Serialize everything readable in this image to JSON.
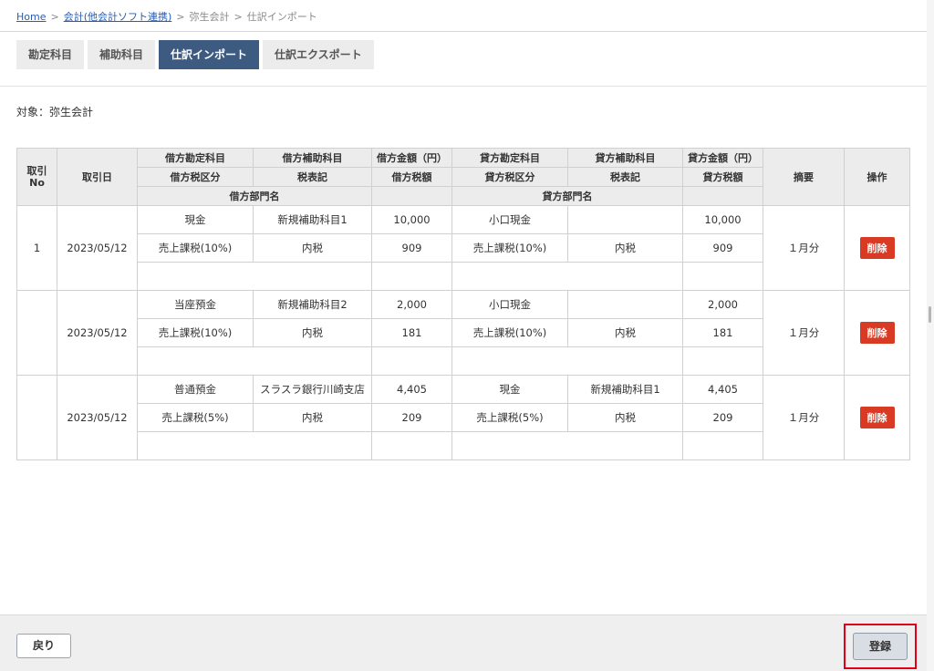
{
  "breadcrumb": {
    "home": "Home",
    "accounting": "会計(他会計ソフト連携)",
    "yayoi": "弥生会計",
    "current": "仕訳インポート",
    "separator": ">"
  },
  "tabs": [
    "勘定科目",
    "補助科目",
    "仕訳インポート",
    "仕訳エクスポート"
  ],
  "active_tab": "仕訳インポート",
  "target_label": "対象：弥生会計",
  "table": {
    "headers": {
      "no": "取引\nNo",
      "date": "取引日",
      "debit_account": "借方勘定科目",
      "debit_sub": "借方補助科目",
      "debit_amount": "借方金額（円）",
      "debit_tax_cat": "借方税区分",
      "tax_notation": "税表記",
      "debit_tax": "借方税額",
      "debit_dept": "借方部門名",
      "credit_account": "貸方勘定科目",
      "credit_sub": "貸方補助科目",
      "credit_amount": "貸方金額（円）",
      "credit_tax_cat": "貸方税区分",
      "credit_tax_notation": "税表記",
      "credit_tax": "貸方税額",
      "credit_dept": "貸方部門名",
      "memo": "摘要",
      "ops": "操作"
    },
    "rows": [
      {
        "no": "1",
        "date": "2023/05/12",
        "debit_account": "現金",
        "debit_sub": "新規補助科目1",
        "debit_amount": "10,000",
        "credit_account": "小口現金",
        "credit_sub": "",
        "credit_amount": "10,000",
        "debit_tax_cat": "売上課税(10%)",
        "debit_tax_note": "内税",
        "debit_tax": "909",
        "credit_tax_cat": "売上課税(10%)",
        "credit_tax_note": "内税",
        "credit_tax": "909",
        "debit_dept": "",
        "credit_dept": "",
        "memo": "１月分",
        "delete": "削除"
      },
      {
        "no": "",
        "date": "2023/05/12",
        "debit_account": "当座預金",
        "debit_sub": "新規補助科目2",
        "debit_amount": "2,000",
        "credit_account": "小口現金",
        "credit_sub": "",
        "credit_amount": "2,000",
        "debit_tax_cat": "売上課税(10%)",
        "debit_tax_note": "内税",
        "debit_tax": "181",
        "credit_tax_cat": "売上課税(10%)",
        "credit_tax_note": "内税",
        "credit_tax": "181",
        "debit_dept": "",
        "credit_dept": "",
        "memo": "１月分",
        "delete": "削除"
      },
      {
        "no": "",
        "date": "2023/05/12",
        "debit_account": "普通預金",
        "debit_sub": "スラスラ銀行川崎支店",
        "debit_amount": "4,405",
        "credit_account": "現金",
        "credit_sub": "新規補助科目1",
        "credit_amount": "4,405",
        "debit_tax_cat": "売上課税(5%)",
        "debit_tax_note": "内税",
        "debit_tax": "209",
        "credit_tax_cat": "売上課税(5%)",
        "credit_tax_note": "内税",
        "credit_tax": "209",
        "debit_dept": "",
        "credit_dept": "",
        "memo": "１月分",
        "delete": "削除"
      }
    ]
  },
  "footer": {
    "back": "戻り",
    "register": "登録"
  },
  "colors": {
    "active_tab": "#3d5a80",
    "delete_button": "#d93a24",
    "highlight_border": "#e0001a"
  }
}
